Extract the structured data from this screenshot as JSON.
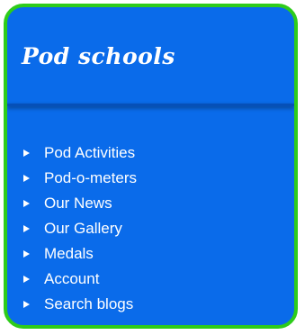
{
  "panel": {
    "title": "Pod schools",
    "items": [
      {
        "label": "Pod Activities",
        "icon": "triangle-right-icon"
      },
      {
        "label": "Pod-o-meters",
        "icon": "triangle-right-icon"
      },
      {
        "label": "Our News",
        "icon": "triangle-right-icon"
      },
      {
        "label": "Our Gallery",
        "icon": "triangle-right-icon"
      },
      {
        "label": "Medals",
        "icon": "triangle-right-icon"
      },
      {
        "label": "Account",
        "icon": "triangle-right-icon"
      },
      {
        "label": "Search blogs",
        "icon": "triangle-right-icon"
      }
    ]
  },
  "colors": {
    "panel_background": "#0a6bea",
    "panel_border": "#2ecc1a",
    "text": "#ffffff"
  }
}
